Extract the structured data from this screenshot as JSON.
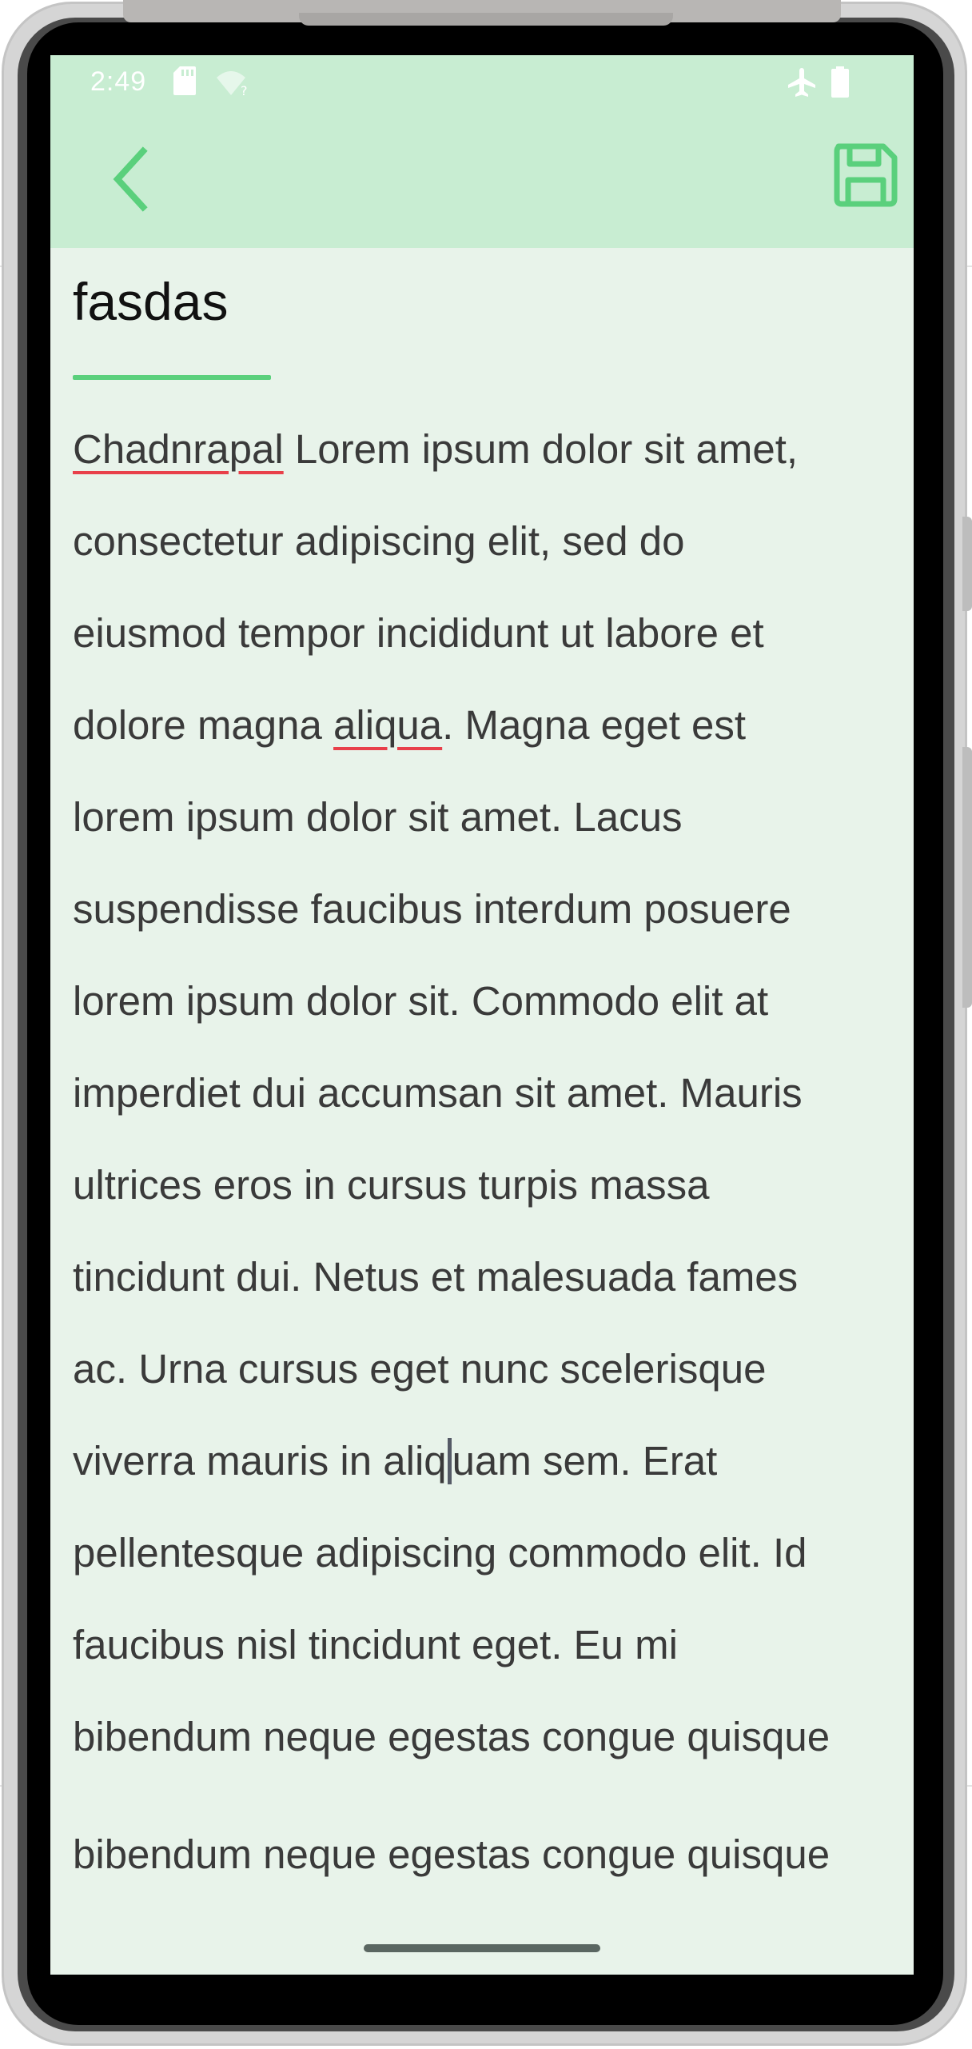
{
  "status_bar": {
    "time": "2:49",
    "icons_left": [
      "sd-card-icon",
      "wifi-question-icon"
    ],
    "icons_right": [
      "airplane-mode-icon",
      "battery-icon"
    ]
  },
  "app_bar": {
    "back_icon": "chevron-left-icon",
    "save_icon": "floppy-disk-save-icon",
    "accent_color": "#5ad07c",
    "background_color": "#c8edd2"
  },
  "note": {
    "title": "fasdas",
    "body_lines": [
      {
        "pre": "",
        "flagged": "Chadnrapal",
        "post": " Lorem ipsum dolor sit amet,"
      },
      {
        "pre": "consectetur adipiscing elit, sed do",
        "flagged": "",
        "post": ""
      },
      {
        "pre": "eiusmod tempor incididunt ut labore et",
        "flagged": "",
        "post": ""
      },
      {
        "pre": "dolore magna ",
        "flagged": "aliqua",
        "post": ". Magna eget est"
      },
      {
        "pre": "lorem ipsum dolor sit amet. Lacus",
        "flagged": "",
        "post": ""
      },
      {
        "pre": "suspendisse faucibus interdum posuere",
        "flagged": "",
        "post": ""
      },
      {
        "pre": "lorem ipsum dolor sit. Commodo elit at",
        "flagged": "",
        "post": ""
      },
      {
        "pre": "imperdiet dui accumsan sit amet. Mauris",
        "flagged": "",
        "post": ""
      },
      {
        "pre": "ultrices eros in cursus turpis massa",
        "flagged": "",
        "post": ""
      },
      {
        "pre": "tincidunt dui. Netus et malesuada fames",
        "flagged": "",
        "post": ""
      },
      {
        "pre": "ac. Urna cursus eget nunc scelerisque",
        "flagged": "",
        "post": ""
      },
      {
        "pre": "viverra mauris in aliq",
        "cursor": true,
        "post": "uam sem. Erat"
      },
      {
        "pre": "pellentesque adipiscing commodo elit. Id",
        "flagged": "",
        "post": ""
      },
      {
        "pre": "faucibus nisl tincidunt eget. Eu mi",
        "flagged": "",
        "post": ""
      },
      {
        "pre": "bibendum neque egestas congue quisque",
        "flagged": "",
        "post": ""
      }
    ],
    "trailing_line": "bibendum neque egestas congue quisque"
  }
}
